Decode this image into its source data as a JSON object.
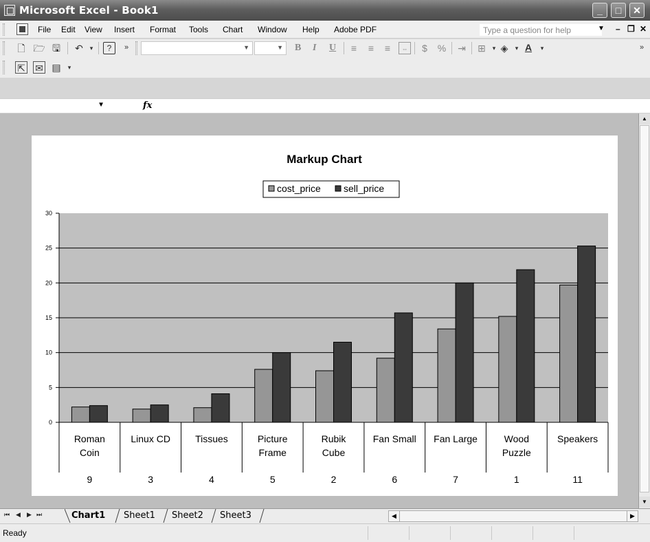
{
  "window": {
    "title": "Microsoft Excel - Book1"
  },
  "menu": {
    "items": [
      "File",
      "Edit",
      "View",
      "Insert",
      "Format",
      "Tools",
      "Chart",
      "Window",
      "Help",
      "Adobe PDF"
    ],
    "help_placeholder": "Type a question for help"
  },
  "formula_bar": {
    "fx_label": "fx"
  },
  "sheet_tabs": [
    "Chart1",
    "Sheet1",
    "Sheet2",
    "Sheet3"
  ],
  "active_tab": "Chart1",
  "status": {
    "text": "Ready"
  },
  "colors": {
    "plot_area": "#c0c0c0",
    "cost_price": "#969696",
    "sell_price": "#3a3a3a"
  },
  "chart_data": {
    "type": "bar",
    "title": "Markup Chart",
    "categories": [
      "Roman Coin",
      "Linux CD",
      "Tissues",
      "Picture Frame",
      "Rubik Cube",
      "Fan Small",
      "Fan Large",
      "Wood Puzzle",
      "Speakers"
    ],
    "category_ids": [
      "9",
      "3",
      "4",
      "5",
      "2",
      "6",
      "7",
      "1",
      "11"
    ],
    "series": [
      {
        "name": "cost_price",
        "values": [
          2.2,
          1.9,
          2.1,
          7.6,
          7.4,
          9.2,
          13.4,
          15.2,
          19.7
        ]
      },
      {
        "name": "sell_price",
        "values": [
          2.4,
          2.5,
          4.1,
          10.0,
          11.5,
          15.7,
          20.0,
          21.9,
          25.3
        ]
      }
    ],
    "ylim": [
      0,
      30
    ],
    "yticks": [
      "0",
      "5",
      "10",
      "15",
      "20",
      "25",
      "30"
    ],
    "grid": true,
    "legend": "top"
  }
}
